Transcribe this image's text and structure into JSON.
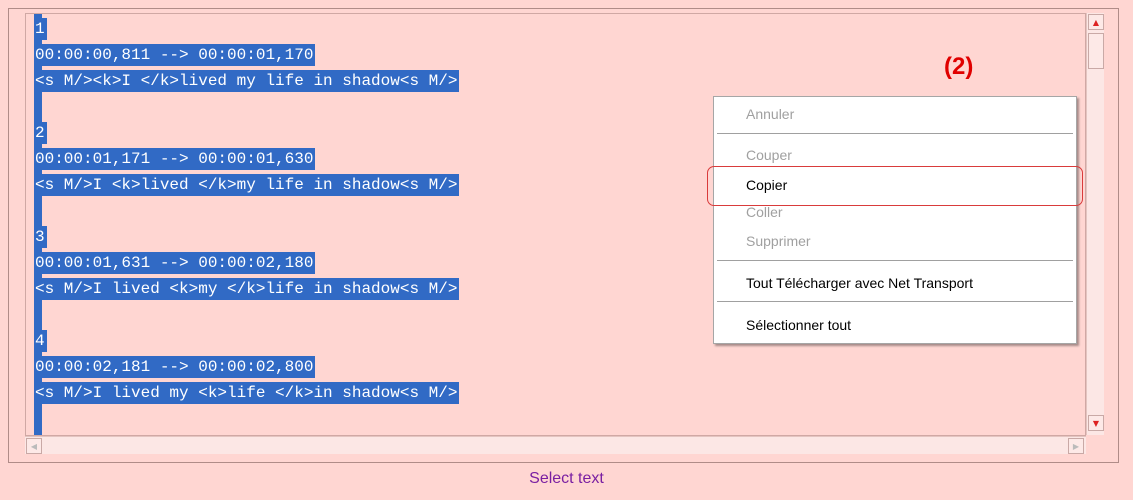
{
  "subtitle_lines": [
    "1",
    "00:00:00,811 --> 00:00:01,170",
    "<s M/><k>I </k>lived my life in shadow<s M/>",
    "",
    "2",
    "00:00:01,171 --> 00:00:01,630",
    "<s M/>I <k>lived </k>my life in shadow<s M/>",
    "",
    "3",
    "00:00:01,631 --> 00:00:02,180",
    "<s M/>I lived <k>my </k>life in shadow<s M/>",
    "",
    "4",
    "00:00:02,181 --> 00:00:02,800",
    "<s M/>I lived my <k>life </k>in shadow<s M/>",
    ""
  ],
  "callout": "(2)",
  "context_menu": {
    "undo": "Annuler",
    "cut": "Couper",
    "copy": "Copier",
    "paste": "Coller",
    "delete": "Supprimer",
    "download_all": "Tout Télécharger avec Net Transport",
    "select_all": "Sélectionner tout"
  },
  "status_text": "Select text",
  "colors": {
    "selection": "#316ac5",
    "background": "#ffd6d2",
    "callout": "#e00000",
    "status_text": "#7a1fa2"
  }
}
